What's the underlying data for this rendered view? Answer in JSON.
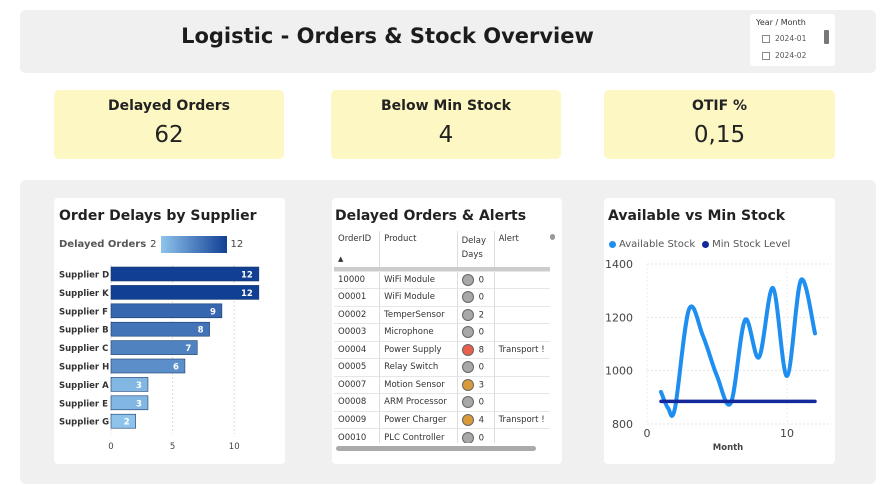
{
  "header": {
    "title": "Logistic - Orders & Stock Overview",
    "slicer": {
      "title": "Year / Month",
      "options": [
        "2024-01",
        "2024-02"
      ]
    }
  },
  "kpis": [
    {
      "label": "Delayed Orders",
      "value": "62"
    },
    {
      "label": "Below Min Stock",
      "value": "4"
    },
    {
      "label": "OTIF %",
      "value": "0,15"
    }
  ],
  "bar_card": {
    "title": "Order Delays by Supplier",
    "legend_label": "Delayed Orders",
    "legend_min": "2",
    "legend_max": "12"
  },
  "table_card": {
    "title": "Delayed Orders & Alerts",
    "columns": [
      "OrderID",
      "Product",
      "Delay Days",
      "Alert"
    ],
    "rows": [
      {
        "id": "10000",
        "product": "WiFi Module",
        "status": "grey",
        "days": "0",
        "alert": ""
      },
      {
        "id": "O0001",
        "product": "WiFi Module",
        "status": "grey",
        "days": "0",
        "alert": ""
      },
      {
        "id": "O0002",
        "product": "TemperSensor",
        "status": "grey",
        "days": "2",
        "alert": ""
      },
      {
        "id": "O0003",
        "product": "Microphone",
        "status": "grey",
        "days": "0",
        "alert": ""
      },
      {
        "id": "O0004",
        "product": "Power Supply",
        "status": "red",
        "days": "8",
        "alert": "Transport !"
      },
      {
        "id": "O0005",
        "product": "Relay Switch",
        "status": "grey",
        "days": "0",
        "alert": ""
      },
      {
        "id": "O0007",
        "product": "Motion Sensor",
        "status": "orange",
        "days": "3",
        "alert": ""
      },
      {
        "id": "O0008",
        "product": "ARM Processor",
        "status": "grey",
        "days": "0",
        "alert": ""
      },
      {
        "id": "O0009",
        "product": "Power Charger",
        "status": "orange",
        "days": "4",
        "alert": "Transport !"
      },
      {
        "id": "O0010",
        "product": "PLC Controller",
        "status": "grey",
        "days": "0",
        "alert": ""
      }
    ]
  },
  "line_card": {
    "title": "Available vs Min Stock"
  },
  "colors": {
    "grey": "#a8a8a8",
    "red": "#e8604c",
    "orange": "#d99a3a",
    "available": "#1e8ff0",
    "min": "#13299b"
  },
  "chart_data": [
    {
      "type": "bar",
      "orientation": "horizontal",
      "title": "Order Delays by Supplier",
      "categories": [
        "Supplier D",
        "Supplier K",
        "Supplier F",
        "Supplier B",
        "Supplier C",
        "Supplier H",
        "Supplier A",
        "Supplier E",
        "Supplier G"
      ],
      "series": [
        {
          "name": "Delayed Orders",
          "values": [
            12,
            12,
            9,
            8,
            7,
            6,
            3,
            3,
            2
          ]
        }
      ],
      "xlim": [
        0,
        12.5
      ],
      "xticks": [
        0,
        5,
        10
      ]
    },
    {
      "type": "line",
      "title": "Available vs Min Stock",
      "xlabel": "Month",
      "ylabel": "",
      "ylim": [
        800,
        1400
      ],
      "xlim": [
        0,
        13
      ],
      "yticks": [
        800,
        1000,
        1200,
        1400
      ],
      "xticks": [
        0,
        10
      ],
      "legend_position": "top",
      "series": [
        {
          "name": "Available Stock",
          "x": [
            1,
            1.5,
            2,
            3,
            4,
            5,
            6,
            7,
            8,
            9,
            10,
            11,
            12
          ],
          "y": [
            920,
            860,
            860,
            1230,
            1130,
            980,
            880,
            1190,
            1050,
            1310,
            980,
            1340,
            1140
          ]
        },
        {
          "name": "Min Stock Level",
          "x": [
            1,
            12
          ],
          "y": [
            885,
            885
          ]
        }
      ]
    }
  ]
}
